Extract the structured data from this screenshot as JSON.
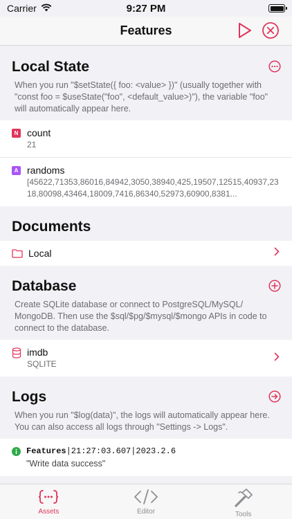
{
  "status": {
    "carrier": "Carrier",
    "time": "9:27 PM"
  },
  "nav": {
    "title": "Features"
  },
  "colors": {
    "accent": "#e0345a",
    "badge_number": "#e0345a",
    "badge_array": "#a855f7",
    "log_ok": "#2eaa4a"
  },
  "local_state": {
    "title": "Local State",
    "description": "When you run \"$setState({ foo: <value> })\" (usually together with \"const foo = $useState(\"foo\", <default_value>)\"), the variable \"foo\" will automatically appear here.",
    "items": [
      {
        "badge": "N",
        "name": "count",
        "value": "21"
      },
      {
        "badge": "A",
        "name": "randoms",
        "value": "[45622,71353,86016,84942,3050,38940,425,19507,12515,40937,2318,80098,43464,18009,7416,86340,52973,60900,8381..."
      }
    ]
  },
  "documents": {
    "title": "Documents",
    "items": [
      {
        "name": "Local"
      }
    ]
  },
  "database": {
    "title": "Database",
    "description": "Create SQLite database or connect to PostgreSQL/MySQL/ MongoDB. Then use the $sql/$pg/$mysql/$mongo APIs in code to connect to the database.",
    "items": [
      {
        "name": "imdb",
        "type": "SQLITE"
      }
    ]
  },
  "logs": {
    "title": "Logs",
    "description": "When you run \"$log(data)\", the logs will automatically appear here. You can also access all logs through \"Settings -> Logs\".",
    "entries": [
      {
        "source": "Features",
        "meta": "|21:27:03.607|2023.2.6",
        "message": "\"Write data success\""
      }
    ]
  },
  "tabs": [
    {
      "label": "Assets",
      "icon": "braces-icon",
      "active": true
    },
    {
      "label": "Editor",
      "icon": "code-icon",
      "active": false
    },
    {
      "label": "Tools",
      "icon": "hammer-icon",
      "active": false
    }
  ]
}
